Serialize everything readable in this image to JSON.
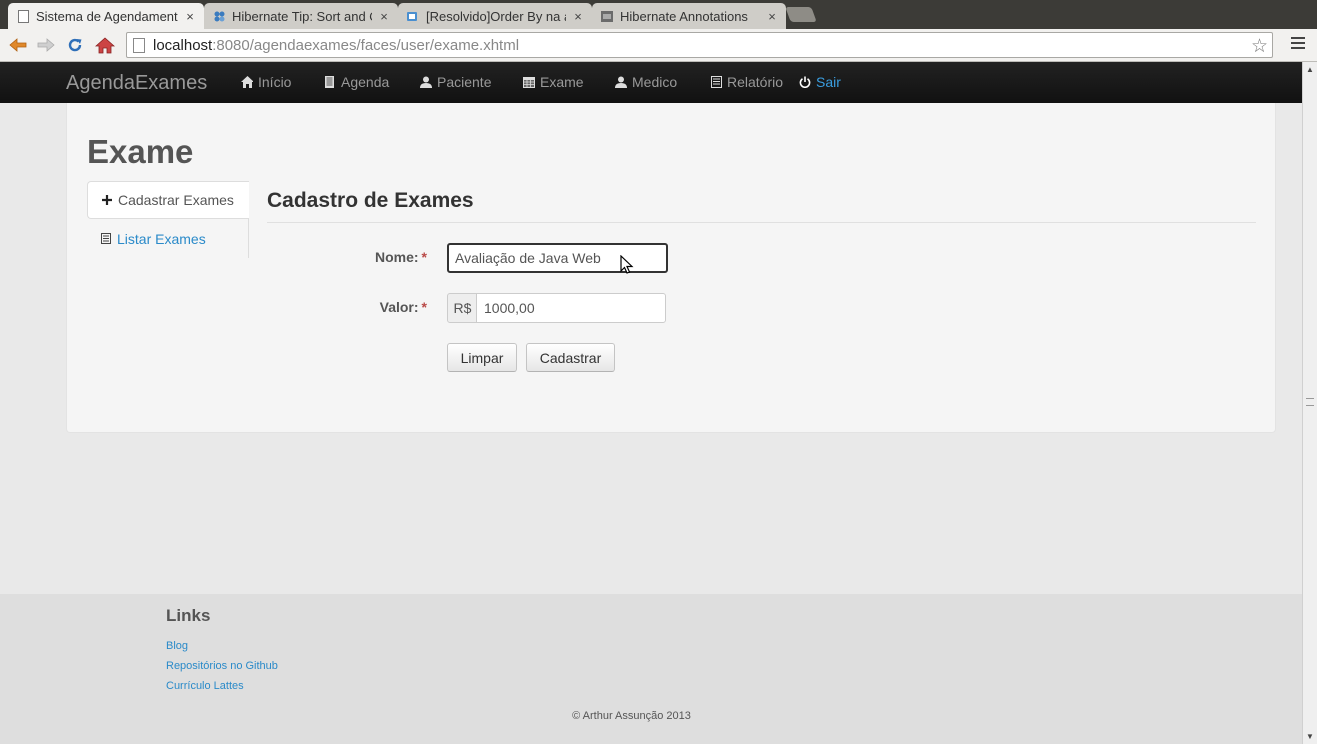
{
  "browser": {
    "tabs": [
      {
        "title": "Sistema de Agendamento",
        "active": true,
        "icon": "page-icon"
      },
      {
        "title": "Hibernate Tip: Sort and O",
        "active": false,
        "icon": "puzzle-icon"
      },
      {
        "title": "[Resolvido]Order By na ar",
        "active": false,
        "icon": "coffee-icon"
      },
      {
        "title": "Hibernate Annotations",
        "active": false,
        "icon": "jboss-icon"
      }
    ],
    "close_glyph": "×",
    "url_host": "localhost",
    "url_path": ":8080/agendaexames/faces/user/exame.xhtml"
  },
  "navbar": {
    "brand": "AgendaExames",
    "items": [
      {
        "label": "Início",
        "icon": "home-icon"
      },
      {
        "label": "Agenda",
        "icon": "book-icon"
      },
      {
        "label": "Paciente",
        "icon": "user-icon"
      },
      {
        "label": "Exame",
        "icon": "calendar-icon"
      },
      {
        "label": "Medico",
        "icon": "user-icon"
      },
      {
        "label": "Relatório",
        "icon": "list-icon"
      },
      {
        "label": "Sair",
        "icon": "off-icon"
      }
    ]
  },
  "page": {
    "title": "Exame",
    "sidenav": [
      {
        "label": "Cadastrar Exames",
        "icon": "plus-icon",
        "active": true
      },
      {
        "label": "Listar Exames",
        "icon": "list-icon",
        "active": false
      }
    ]
  },
  "form": {
    "title": "Cadastro de Exames",
    "required_marker": "*",
    "nome_label": "Nome:",
    "nome_value": "Avaliação de Java Web",
    "valor_label": "Valor:",
    "valor_prefix": "R$",
    "valor_value": "1000,00",
    "limpar_label": "Limpar",
    "cadastrar_label": "Cadastrar"
  },
  "footer": {
    "heading": "Links",
    "links": [
      "Blog",
      "Repositórios no Github",
      "Currículo Lattes"
    ],
    "copyright": "© Arthur Assunção 2013"
  },
  "colors": {
    "navbar_bg": "#1b1b1b",
    "link": "#2a8ac9",
    "required": "#b94a48",
    "logout": "#3a9ee0"
  }
}
